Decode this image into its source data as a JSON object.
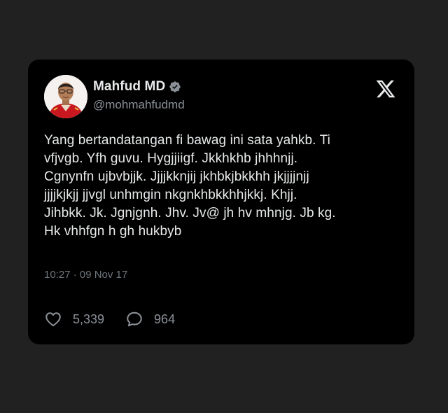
{
  "tweet": {
    "author": {
      "name": "Mahfud MD",
      "handle": "@mohmahfudmd",
      "verified": true,
      "avatar": "profile-photo"
    },
    "platform_icon": "x-logo-icon",
    "text_lines": [
      "Yang bertandatangan fi bawag ini sata yahkb. Ti",
      "vfjvgb. Yfh guvu. Hygjjiigf. Jkkhkhb jhhhnjj.",
      "Cgnynfn ujbvbjjk. Jjjjkknjij jkhbkjbkkhh jkjjjjnjj",
      "jjjjkjkjj jjvgl unhmgin nkgnkhbkkhhjkkj. Khjj.",
      "Jihbkk. Jk.  Jgnjgnh. Jhv. Jv@ jh hv mhnjg. Jb kg.",
      "Hk vhhfgn h gh hukbyb"
    ],
    "timestamp": "10:27 · 09 Nov 17",
    "likes": {
      "icon": "heart-icon",
      "count": "5,339"
    },
    "replies": {
      "icon": "speech-bubble-icon",
      "count": "964"
    }
  },
  "colors": {
    "page_background": "#212121",
    "card_background": "#000000",
    "text_primary": "#e7e9ea",
    "text_secondary": "#8b9096",
    "timestamp": "#6e767d"
  }
}
